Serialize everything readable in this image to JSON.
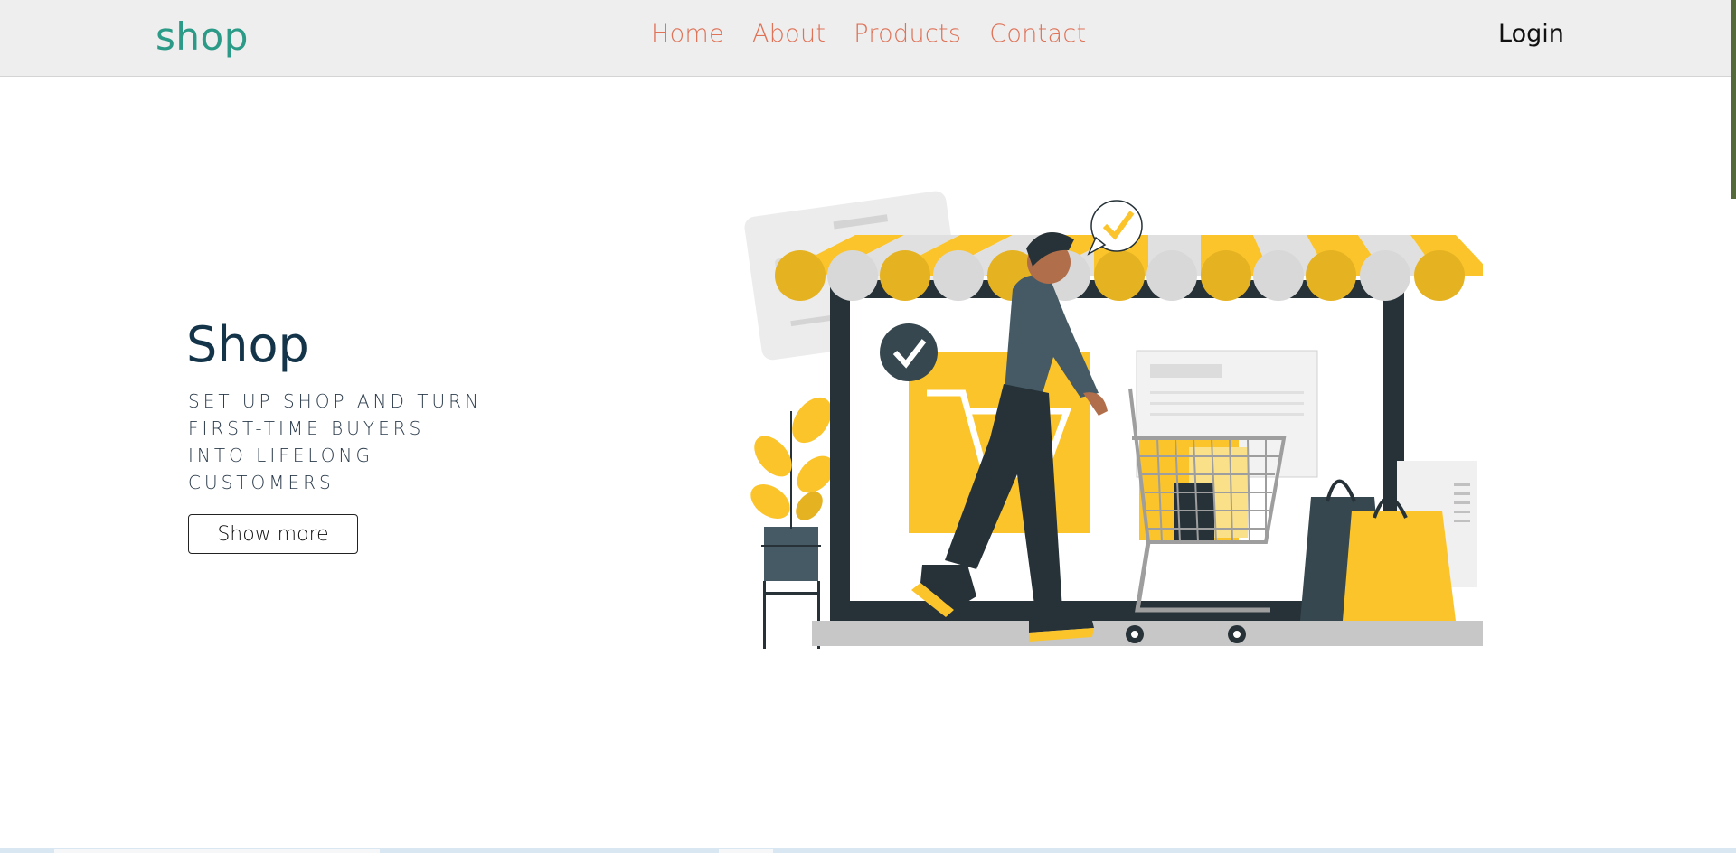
{
  "navbar": {
    "brand": "shop",
    "links": [
      "Home",
      "About",
      "Products",
      "Contact"
    ],
    "login": "Login"
  },
  "hero": {
    "title": "Shop",
    "subtitle": "SET UP SHOP AND TURN FIRST-TIME BUYERS INTO LIFELONG CUSTOMERS",
    "button": "Show more"
  },
  "colors": {
    "brand": "#2b9a87",
    "nav_link": "#df7257",
    "title": "#14344a",
    "accent_yellow": "#fbc42b",
    "dark_slate": "#263238"
  }
}
